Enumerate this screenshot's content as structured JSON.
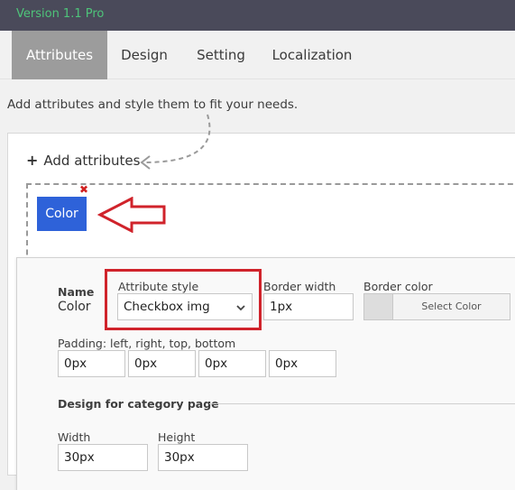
{
  "header": {
    "version": "Version 1.1 Pro"
  },
  "tabs": [
    {
      "label": "Attributes",
      "active": true
    },
    {
      "label": "Design",
      "active": false
    },
    {
      "label": "Setting",
      "active": false
    },
    {
      "label": "Localization",
      "active": false
    }
  ],
  "main": {
    "description": "Add attributes and style them to fit your needs.",
    "add_attributes_label": "Add attributes",
    "attribute_chip_label": "Color",
    "remove_glyph": "✖"
  },
  "settings": {
    "name_label": "Name",
    "name_value": "Color",
    "attribute_style_label": "Attribute style",
    "attribute_style_value": "Checkbox img",
    "border_width_label": "Border width",
    "border_width_value": "1px",
    "border_color_label": "Border color",
    "select_color_label": "Select Color",
    "padding_label": "Padding: left, right, top, bottom",
    "padding_values": [
      "0px",
      "0px",
      "0px",
      "0px"
    ],
    "category_section_label": "Design for category page",
    "width_label": "Width",
    "width_value": "30px",
    "height_label": "Height",
    "height_value": "30px"
  },
  "colors": {
    "topbar": "#4a4a5a",
    "version_text": "#4ec47a",
    "active_tab": "#9c9c9c",
    "chip": "#2e62d9",
    "highlight": "#d0232b"
  }
}
